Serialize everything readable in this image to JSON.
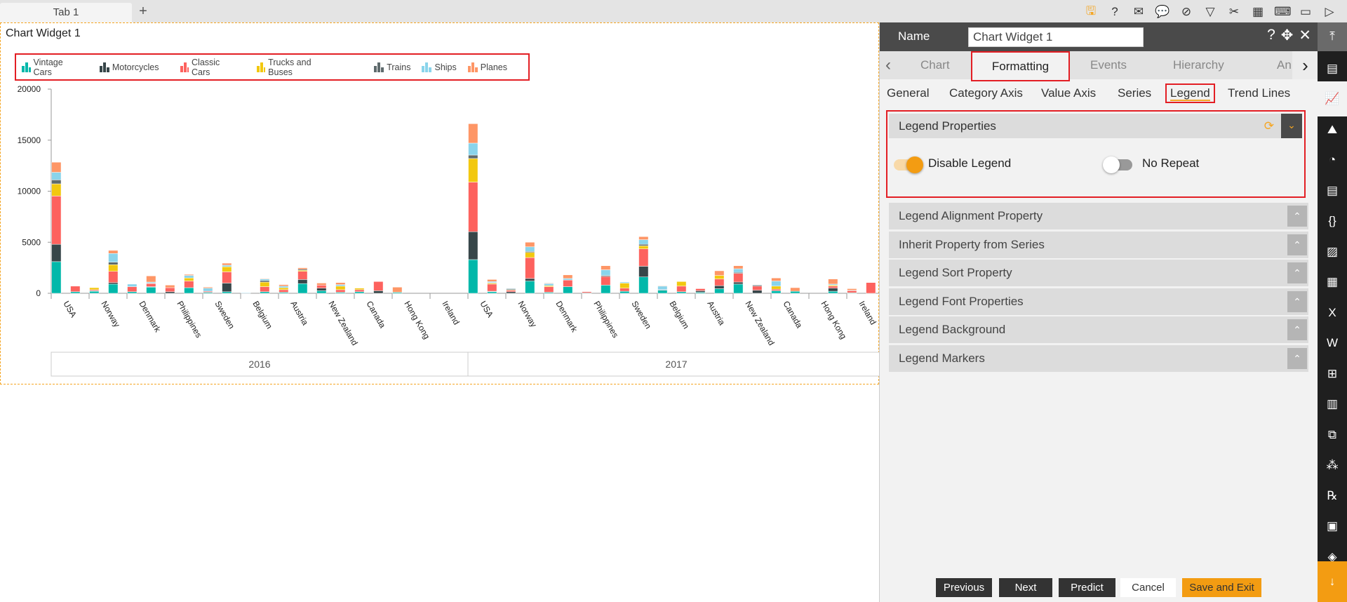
{
  "tabbar": {
    "tab": "Tab 1",
    "add": "+"
  },
  "toolbar": {
    "icons": [
      "save-icon",
      "help-icon",
      "mail-icon",
      "comment-icon",
      "clear-filter-icon",
      "filter-icon",
      "tools-icon",
      "table-icon",
      "embed-icon",
      "devices-icon",
      "play-icon"
    ],
    "glyphs": [
      "🖫",
      "?",
      "✉",
      "💬",
      "⊘",
      "▽",
      "✂",
      "▦",
      "⌨",
      "▭",
      "▷"
    ]
  },
  "widget": {
    "title": "Chart Widget 1"
  },
  "chart_data": {
    "type": "bar",
    "stacked": true,
    "series_names": [
      "Vintage Cars",
      "Motorcycles",
      "Classic Cars",
      "Trucks and Buses",
      "Trains",
      "Ships",
      "Planes"
    ],
    "colors": [
      "#01b8aa",
      "#374649",
      "#fd625e",
      "#f2c80f",
      "#5f6b6d",
      "#8ad4eb",
      "#fe9666"
    ],
    "legend_position": "top",
    "ylim": [
      0,
      20000
    ],
    "yticks": [
      "0",
      "5000",
      "10000",
      "15000",
      "20000"
    ],
    "years": [
      "2016",
      "2017"
    ],
    "countries": [
      "USA",
      "Norway",
      "Denmark",
      "Philippines",
      "Sweden",
      "Belgium",
      "Austria",
      "New Zealand",
      "Canada",
      "Hong Kong",
      "Ireland"
    ],
    "bars": {
      "2016": [
        [
          [
            3100,
            1700,
            4730,
            1190,
            390,
            740,
            990
          ],
          [
            150,
            0,
            550,
            0,
            0,
            0,
            0
          ]
        ],
        [
          [
            200,
            50,
            100,
            200,
            0,
            0,
            0
          ],
          [
            900,
            150,
            1100,
            650,
            250,
            850,
            300
          ]
        ],
        [
          [
            150,
            0,
            500,
            0,
            0,
            250,
            0
          ],
          [
            600,
            50,
            300,
            0,
            50,
            100,
            600
          ]
        ],
        [
          [
            0,
            150,
            400,
            0,
            0,
            0,
            250
          ],
          [
            550,
            0,
            650,
            300,
            0,
            250,
            100
          ]
        ],
        [
          [
            100,
            0,
            100,
            0,
            0,
            300,
            100
          ],
          [
            150,
            850,
            1100,
            500,
            0,
            150,
            200
          ]
        ],
        [
          [
            0,
            0,
            0,
            0,
            0,
            60,
            0
          ],
          [
            150,
            0,
            500,
            450,
            150,
            150,
            50
          ]
        ],
        [
          [
            100,
            0,
            250,
            200,
            0,
            150,
            150
          ],
          [
            950,
            400,
            800,
            100,
            100,
            0,
            150
          ]
        ],
        [
          [
            250,
            250,
            300,
            0,
            0,
            0,
            200
          ],
          [
            100,
            0,
            250,
            350,
            0,
            150,
            200
          ]
        ],
        [
          [
            150,
            0,
            200,
            150,
            0,
            0,
            0
          ],
          [
            0,
            250,
            900,
            0,
            0,
            0,
            0
          ]
        ],
        [
          [
            100,
            0,
            0,
            0,
            0,
            0,
            500
          ],
          [
            0,
            0,
            0,
            0,
            0,
            0,
            0
          ]
        ],
        [
          [
            0,
            0,
            0,
            0,
            0,
            0,
            0
          ],
          [
            0,
            0,
            0,
            0,
            0,
            0,
            0
          ]
        ]
      ],
      "2017": [
        [
          [
            3300,
            2730,
            4860,
            2310,
            340,
            1170,
            1900
          ],
          [
            150,
            50,
            700,
            100,
            50,
            100,
            200
          ]
        ],
        [
          [
            0,
            150,
            150,
            50,
            100,
            50,
            0
          ],
          [
            1200,
            250,
            2050,
            500,
            100,
            450,
            450
          ]
        ],
        [
          [
            100,
            0,
            550,
            100,
            0,
            200,
            50
          ],
          [
            650,
            0,
            650,
            0,
            0,
            150,
            350
          ]
        ],
        [
          [
            0,
            50,
            100,
            0,
            0,
            0,
            0
          ],
          [
            800,
            0,
            850,
            0,
            100,
            550,
            400
          ]
        ],
        [
          [
            200,
            0,
            300,
            500,
            0,
            100,
            0
          ],
          [
            1600,
            1050,
            1700,
            300,
            150,
            450,
            300
          ]
        ],
        [
          [
            300,
            50,
            0,
            0,
            0,
            350,
            50
          ],
          [
            150,
            0,
            550,
            450,
            0,
            0,
            0
          ]
        ],
        [
          [
            100,
            150,
            200,
            0,
            0,
            0,
            0
          ],
          [
            450,
            300,
            650,
            350,
            0,
            0,
            450
          ]
        ],
        [
          [
            900,
            200,
            850,
            0,
            100,
            350,
            300
          ],
          [
            0,
            300,
            400,
            0,
            100,
            0,
            0
          ]
        ],
        [
          [
            250,
            0,
            150,
            300,
            0,
            500,
            300
          ],
          [
            200,
            0,
            0,
            0,
            0,
            0,
            350
          ]
        ],
        [
          [
            0,
            0,
            0,
            0,
            0,
            0,
            0
          ],
          [
            200,
            300,
            200,
            100,
            0,
            100,
            500
          ]
        ],
        [
          [
            50,
            0,
            200,
            0,
            50,
            0,
            150
          ],
          [
            0,
            0,
            1050,
            0,
            0,
            0,
            0
          ]
        ]
      ]
    }
  },
  "panel": {
    "name_label": "Name",
    "name_value": "Chart Widget 1",
    "tabs": [
      "Chart",
      "Formatting",
      "Events",
      "Hierarchy",
      "Annot"
    ],
    "subtabs": [
      "General",
      "Category Axis",
      "Value Axis",
      "Series",
      "Legend",
      "Trend Lines"
    ],
    "legend_properties": {
      "title": "Legend Properties",
      "disable_legend": {
        "label": "Disable Legend",
        "on": true
      },
      "no_repeat": {
        "label": "No Repeat",
        "on": false
      }
    },
    "sections": [
      "Legend Alignment Property",
      "Inherit Property from Series",
      "Legend Sort Property",
      "Legend Font Properties",
      "Legend Background",
      "Legend Markers"
    ],
    "buttons": {
      "previous": "Previous",
      "next": "Next",
      "predict": "Predict",
      "cancel": "Cancel",
      "save": "Save and Exit"
    }
  },
  "sidebar": {
    "icons": [
      "move-top-icon",
      "widget-icon",
      "chart-icon",
      "map-icon",
      "report-icon",
      "document-icon",
      "code-braces-icon",
      "image-icon",
      "table-icon",
      "excel-icon",
      "word-icon",
      "tree-icon",
      "bar-chart-icon",
      "copy-icon",
      "cubes-icon",
      "formula-icon",
      "file-icon",
      "layers-icon",
      "download-icon"
    ],
    "glyphs": [
      "⤒",
      "▤",
      "📈",
      "⛰",
      "◔",
      "▤",
      "{}",
      "▨",
      "▦",
      "X",
      "W",
      "⊞",
      "▥",
      "⧉",
      "⁂",
      "℞",
      "▣",
      "◈",
      "↓"
    ]
  }
}
